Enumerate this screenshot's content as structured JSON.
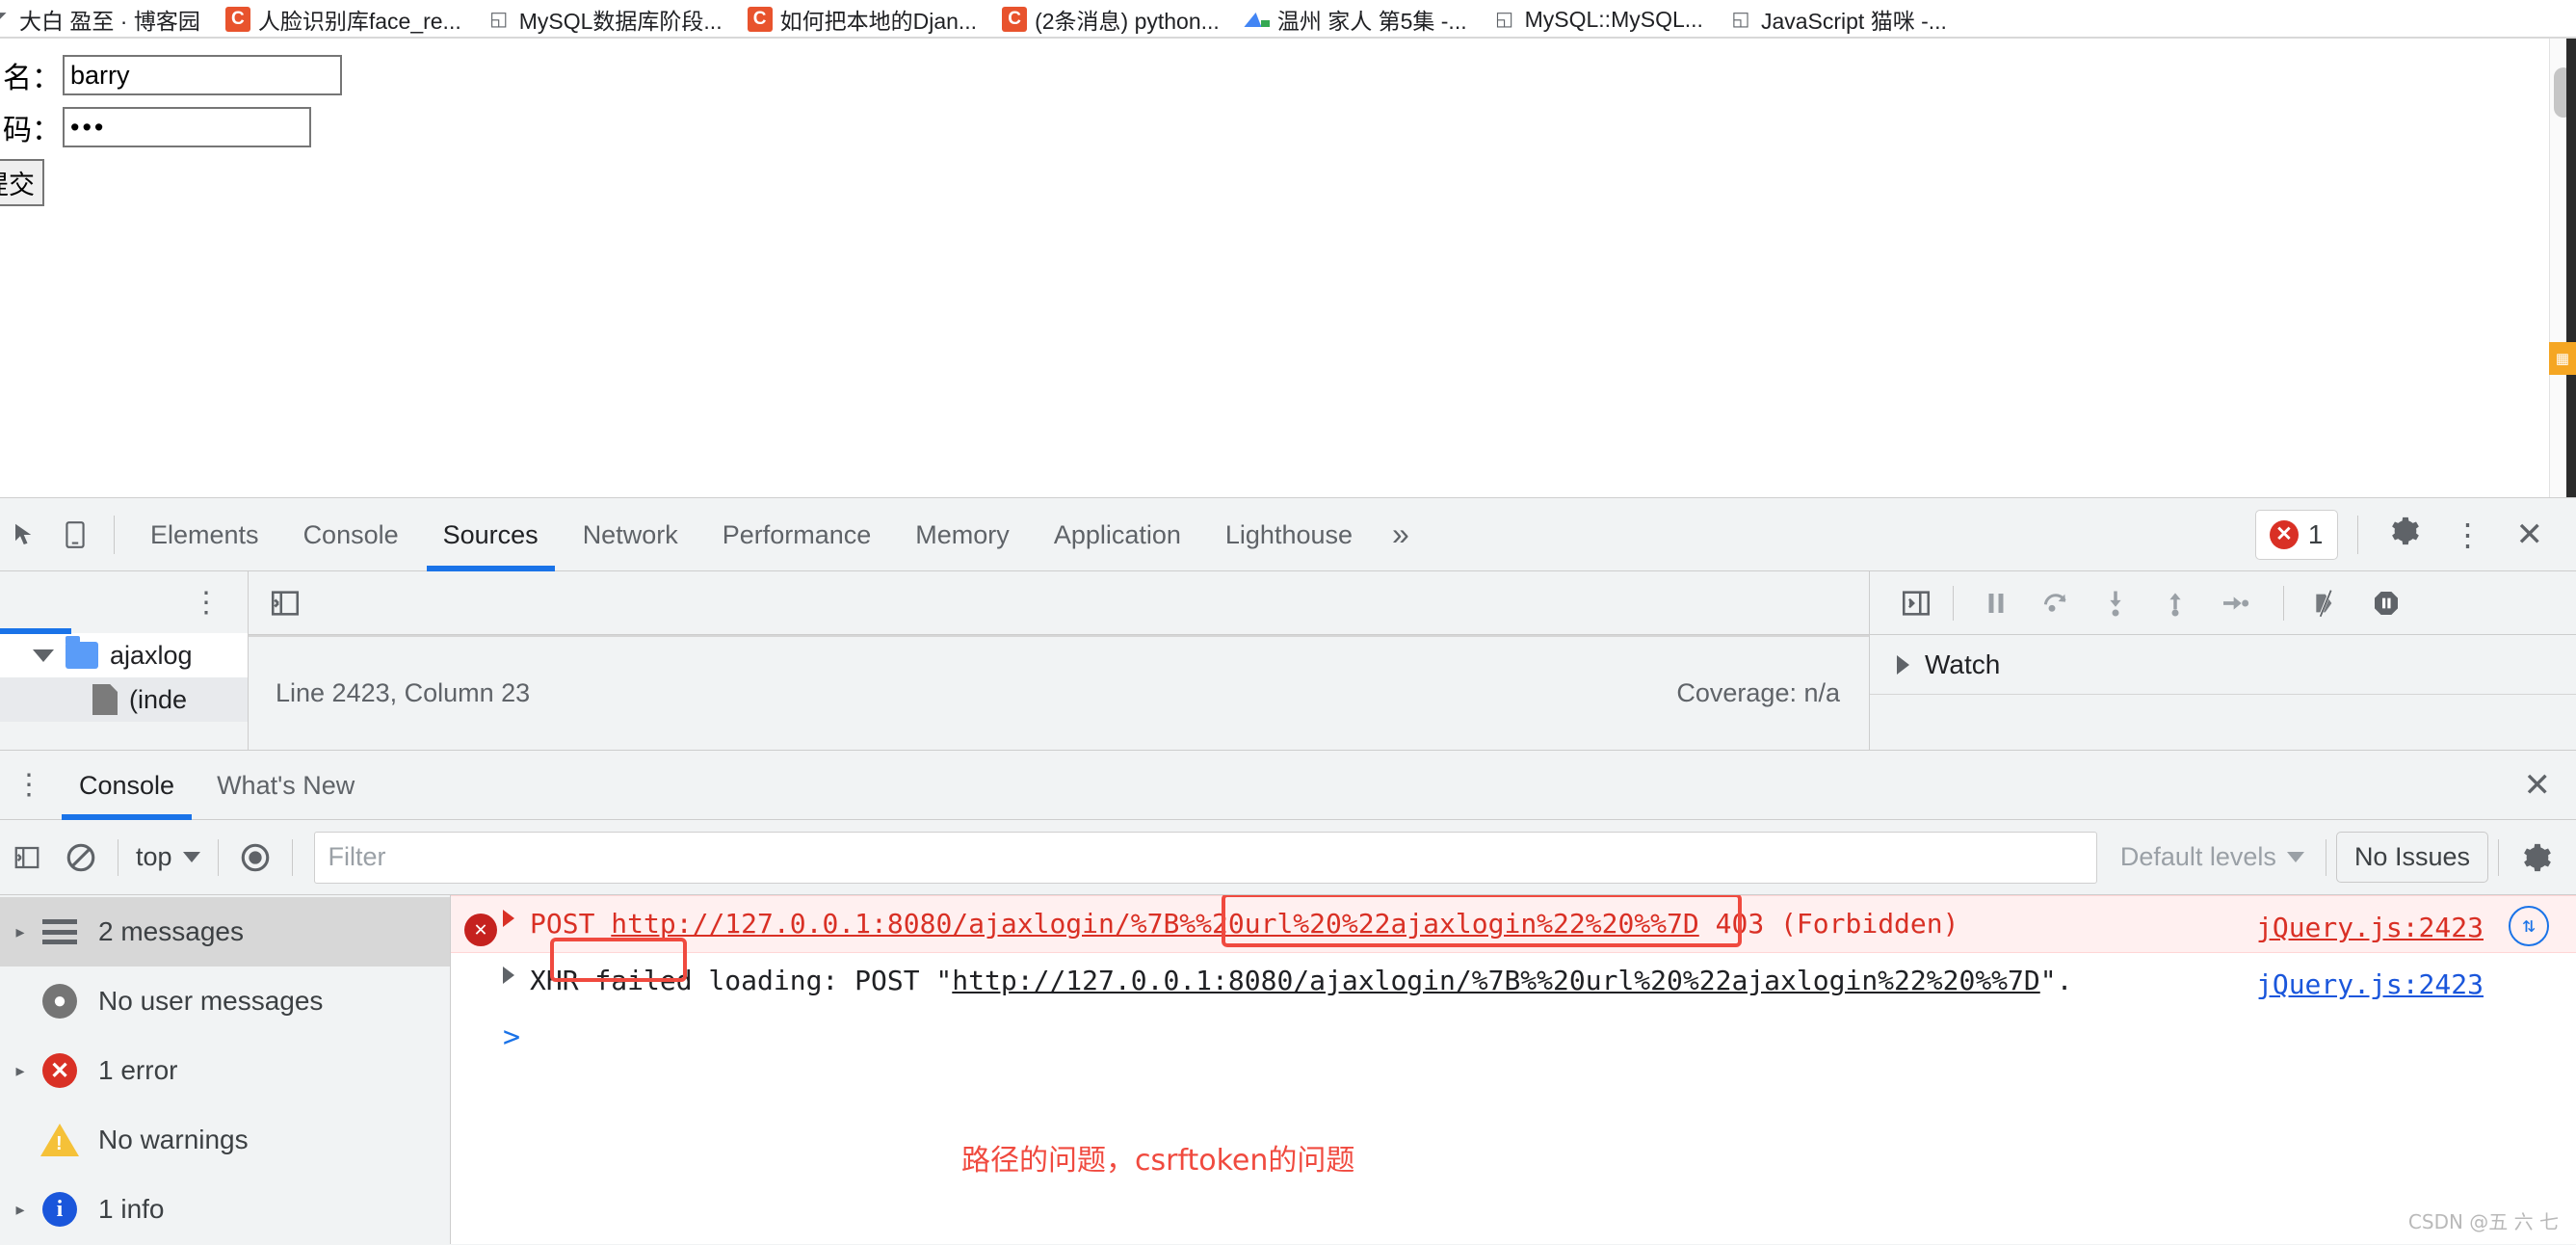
{
  "bookmarks": [
    {
      "label": "大白 盈至 · 博客园",
      "icon": "edge-icon"
    },
    {
      "label": "人脸识别库face_re...",
      "icon": "csdn-icon"
    },
    {
      "label": "MySQL数据库阶段...",
      "icon": "doc-icon"
    },
    {
      "label": "如何把本地的Djan...",
      "icon": "csdn-icon"
    },
    {
      "label": "(2条消息) python...",
      "icon": "csdn-icon"
    },
    {
      "label": "温州  家人 第5集 -...",
      "icon": "video-icon"
    },
    {
      "label": "MySQL::MySQL...",
      "icon": "doc-icon"
    },
    {
      "label": "JavaScript 猫咪 -...",
      "icon": "doc-icon"
    }
  ],
  "page_form": {
    "username_label": "户名：",
    "username_value": "barry",
    "password_label": "码：",
    "password_value": "•••",
    "submit_label": "提交"
  },
  "devtools": {
    "tabs": [
      {
        "label": "Elements",
        "active": false
      },
      {
        "label": "Console",
        "active": false
      },
      {
        "label": "Sources",
        "active": true
      },
      {
        "label": "Network",
        "active": false
      },
      {
        "label": "Performance",
        "active": false
      },
      {
        "label": "Memory",
        "active": false
      },
      {
        "label": "Application",
        "active": false
      },
      {
        "label": "Lighthouse",
        "active": false
      }
    ],
    "more_tabs_glyph": "»",
    "error_count": "1",
    "settings_glyph": "✿",
    "kebab_glyph": "⋮",
    "close_glyph": "✕"
  },
  "sources": {
    "tree": [
      {
        "label": "ajaxlog",
        "type": "folder"
      },
      {
        "label": "(inde",
        "type": "file"
      }
    ],
    "status_line": "Line 2423, Column 23",
    "coverage": "Coverage: n/a",
    "debugger_sections": [
      {
        "label": "Watch"
      }
    ]
  },
  "drawer": {
    "tabs": [
      {
        "label": "Console",
        "active": true
      },
      {
        "label": "What's New",
        "active": false
      }
    ],
    "close_glyph": "✕"
  },
  "console_toolbar": {
    "context_value": "top",
    "filter_placeholder": "Filter",
    "filter_value": "",
    "levels_label": "Default levels",
    "issues_label": "No Issues"
  },
  "console_sidebar": [
    {
      "label": "2 messages",
      "icon": "list-icon",
      "selected": true,
      "expandable": true
    },
    {
      "label": "No user messages",
      "icon": "user-icon",
      "selected": false,
      "expandable": false
    },
    {
      "label": "1 error",
      "icon": "error-icon",
      "selected": false,
      "expandable": true
    },
    {
      "label": "No warnings",
      "icon": "warning-icon",
      "selected": false,
      "expandable": false
    },
    {
      "label": "1 info",
      "icon": "info-icon",
      "selected": false,
      "expandable": true
    }
  ],
  "console_messages": [
    {
      "kind": "error",
      "method": "POST ",
      "url": "http://127.0.0.1:8080/ajaxlogin/%7B%%20url%20%22ajaxlogin%22%20%%7D",
      "status": " 403 ",
      "status_detail": "(Forbidden)",
      "source": "jQuery.js:2423"
    },
    {
      "kind": "plain",
      "prefix": "XHR failed loading: POST \"",
      "url": "http://127.0.0.1:8080/ajaxlogin/%7B%%20url%20%22ajaxlogin%22%20%%7D",
      "suffix": "\".",
      "source": "jQuery.js:2423"
    }
  ],
  "console_prompt_glyph": ">",
  "annotation": {
    "note": "路径的问题，csrftoken的问题",
    "color": "#f04a3f"
  },
  "watermark": "CSDN @五 六 七"
}
